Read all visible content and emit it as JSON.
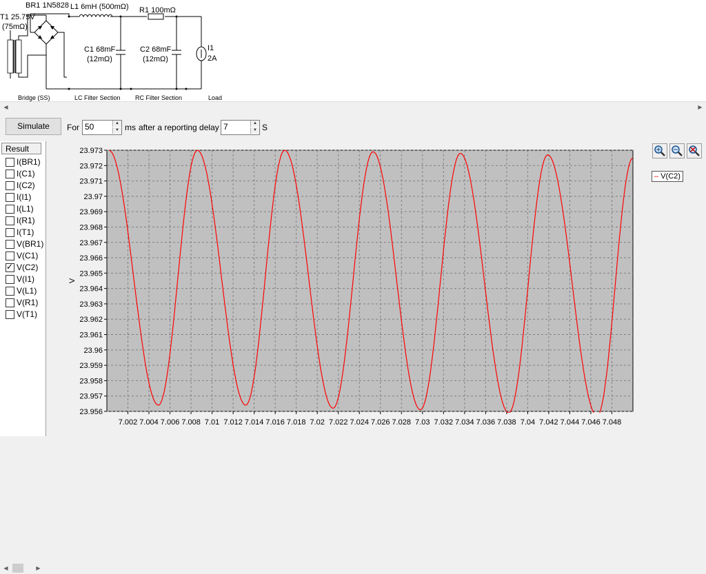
{
  "schematic": {
    "t1_line1": "T1 25.75V",
    "t1_line2": "(75mΩ)",
    "br1_label": "BR1 1N5828",
    "l1_label": "L1 6mH (500mΩ)",
    "r1_label": "R1 100mΩ",
    "c1_line1": "C1 68mF",
    "c1_line2": "(12mΩ)",
    "c2_line1": "C2 68mF",
    "c2_line2": "(12mΩ)",
    "i1_line1": "I1",
    "i1_line2": "2A",
    "section_bridge": "Bridge (SS)",
    "section_lc": "LC Filter Section",
    "section_rc": "RC Filter Section",
    "section_load": "Load"
  },
  "toolbar": {
    "simulate_label": "Simulate",
    "for_label": "For",
    "for_value": "50",
    "ms_label": "ms",
    "delay_label": "after a reporting delay of",
    "delay_value": "7",
    "s_label": "S"
  },
  "results": {
    "header": "Result",
    "items": [
      {
        "label": "I(BR1)",
        "checked": false
      },
      {
        "label": "I(C1)",
        "checked": false
      },
      {
        "label": "I(C2)",
        "checked": false
      },
      {
        "label": "I(I1)",
        "checked": false
      },
      {
        "label": "I(L1)",
        "checked": false
      },
      {
        "label": "I(R1)",
        "checked": false
      },
      {
        "label": "I(T1)",
        "checked": false
      },
      {
        "label": "V(BR1)",
        "checked": false
      },
      {
        "label": "V(C1)",
        "checked": false
      },
      {
        "label": "V(C2)",
        "checked": true
      },
      {
        "label": "V(I1)",
        "checked": false
      },
      {
        "label": "V(L1)",
        "checked": false
      },
      {
        "label": "V(R1)",
        "checked": false
      },
      {
        "label": "V(T1)",
        "checked": false
      }
    ]
  },
  "legend_label": "V(C2)",
  "chart_data": {
    "type": "line",
    "ylabel": "V",
    "xlim": [
      7.0,
      7.05
    ],
    "ylim": [
      23.956,
      23.973
    ],
    "x_ticks": [
      "7.002",
      "7.004",
      "7.006",
      "7.008",
      "7.01",
      "7.012",
      "7.014",
      "7.016",
      "7.018",
      "7.02",
      "7.022",
      "7.024",
      "7.026",
      "7.028",
      "7.03",
      "7.032",
      "7.034",
      "7.036",
      "7.038",
      "7.04",
      "7.042",
      "7.044",
      "7.046",
      "7.048"
    ],
    "y_ticks": [
      "23.973",
      "23.972",
      "23.971",
      "23.97",
      "23.969",
      "23.968",
      "23.967",
      "23.966",
      "23.965",
      "23.964",
      "23.963",
      "23.962",
      "23.961",
      "23.96",
      "23.959",
      "23.958",
      "23.957",
      "23.956"
    ],
    "grid": true,
    "series": [
      {
        "name": "V(C2)",
        "color": "#ff0000",
        "peaks": [
          [
            7.0002,
            23.973
          ],
          [
            7.0086,
            23.973
          ],
          [
            7.0169,
            23.973
          ],
          [
            7.0253,
            23.9729
          ],
          [
            7.0336,
            23.9728
          ],
          [
            7.0419,
            23.9727
          ]
        ],
        "troughs": [
          [
            7.0049,
            23.9564
          ],
          [
            7.0132,
            23.9564
          ],
          [
            7.0215,
            23.9562
          ],
          [
            7.0298,
            23.9561
          ],
          [
            7.0382,
            23.9559
          ],
          [
            7.0466,
            23.9557
          ]
        ],
        "end": [
          7.05,
          23.9725
        ]
      }
    ]
  }
}
